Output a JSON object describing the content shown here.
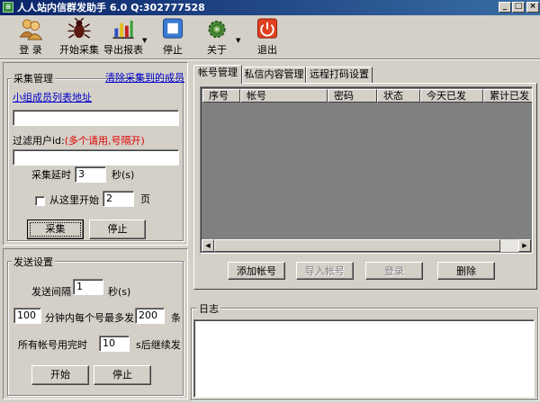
{
  "window": {
    "title": "人人站内信群发助手 6.0 Q:302777528",
    "minimize": "_",
    "maximize": "□",
    "close": "×"
  },
  "toolbar": {
    "login": "登 录",
    "start_collect": "开始采集",
    "export_report": "导出报表",
    "stop": "停止",
    "about": "关于",
    "exit": "退出",
    "dropdown_glyph": "▼"
  },
  "collect": {
    "group_title": "采集管理",
    "clear_link": "清除采集到的成员",
    "group_url_link": "小组成员列表地址",
    "group_url_value": "",
    "filter_label_prefix": "过滤用户id:",
    "filter_hint": "(多个请用,号隔开)",
    "filter_value": "",
    "delay_label": "采集延时",
    "delay_value": "3",
    "delay_unit": "秒(s)",
    "start_here_label": "从这里开始",
    "start_page_value": "2",
    "page_unit": "页",
    "collect_button": "采集",
    "stop_button": "停止"
  },
  "send": {
    "group_title": "发送设置",
    "interval_label": "发送间隔",
    "interval_value": "1",
    "interval_unit": "秒(s)",
    "minutes_value": "100",
    "per_account_label": "分钟内每个号最多发",
    "max_value": "200",
    "count_unit": "条",
    "all_used_label": "所有帐号用完时",
    "resume_value": "10",
    "resume_label": "s后继续发",
    "start_button": "开始",
    "stop_button": "停止"
  },
  "tabs": {
    "account": "帐号管理",
    "message": "私信内容管理",
    "captcha": "远程打码设置"
  },
  "accounts_table": {
    "columns": [
      "序号",
      "帐号",
      "密码",
      "状态",
      "今天已发",
      "累计已发"
    ],
    "rows": []
  },
  "account_buttons": {
    "add": "添加帐号",
    "import": "导入帐号",
    "login": "登录",
    "delete": "删除"
  },
  "log": {
    "title": "日志",
    "content": ""
  },
  "scroll": {
    "left": "◀",
    "right": "▶"
  }
}
